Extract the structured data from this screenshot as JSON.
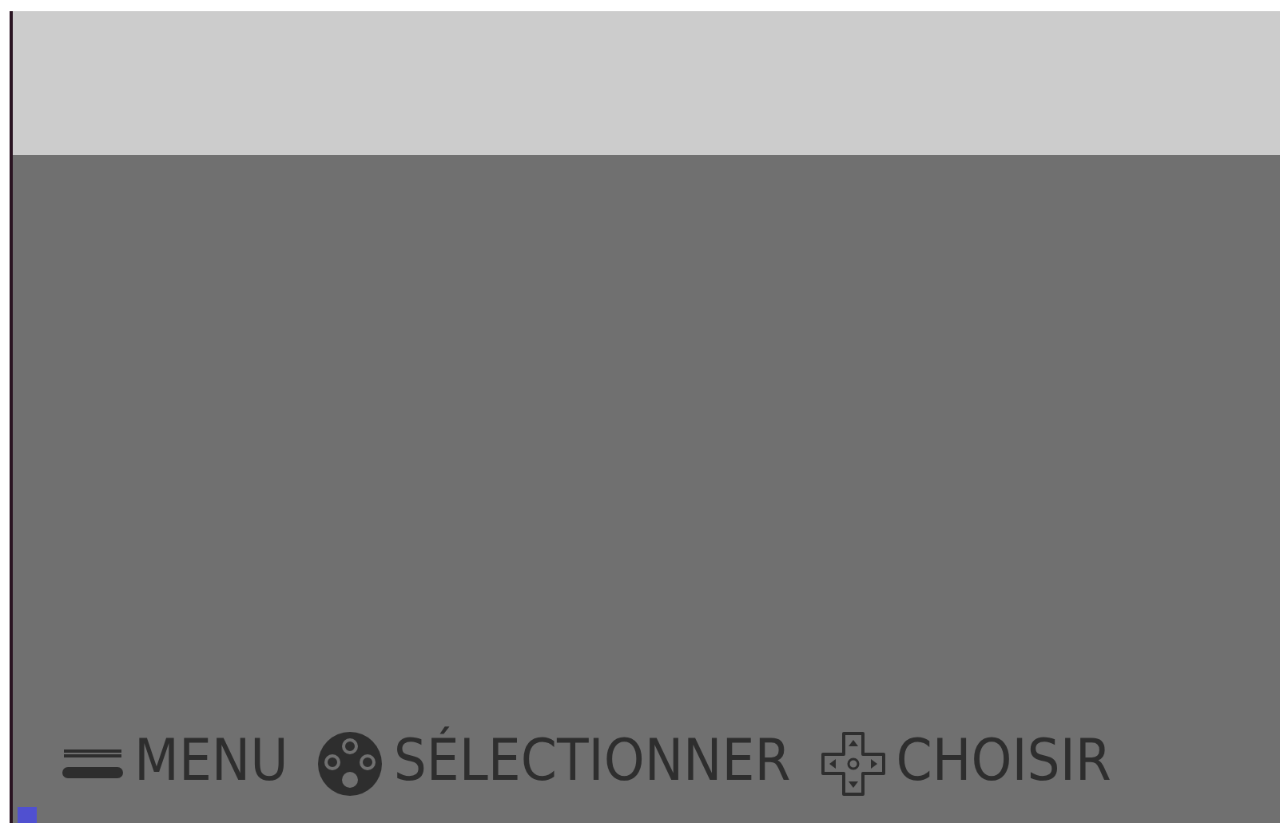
{
  "help_bar": [
    {
      "kind": "start",
      "label": "MENU"
    },
    {
      "kind": "buttons",
      "label": "SÉLECTIONNER"
    },
    {
      "kind": "dpad",
      "label": "CHOISIR"
    }
  ]
}
